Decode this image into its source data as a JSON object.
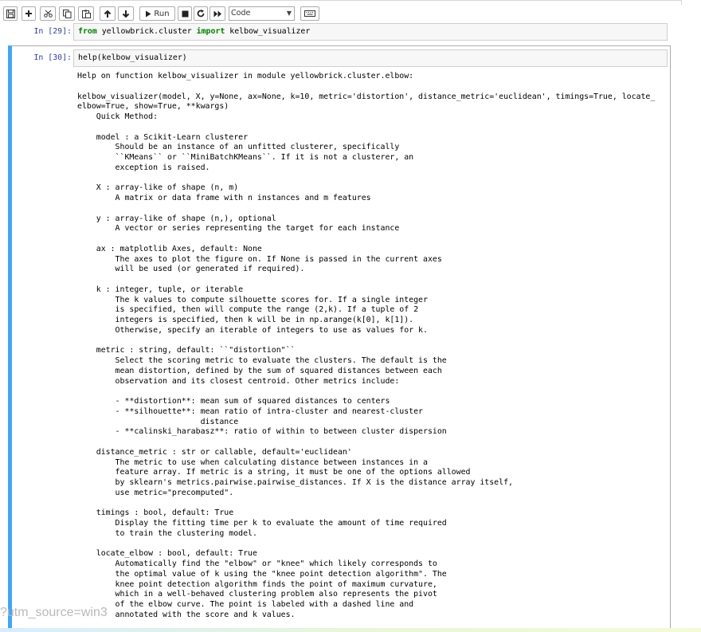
{
  "toolbar": {
    "run_label": "Run",
    "cell_type": "Code",
    "icons": [
      "save-icon",
      "add-icon",
      "cut-icon",
      "copy-icon",
      "paste-icon",
      "move-up-icon",
      "move-down-icon",
      "run-icon",
      "stop-icon",
      "restart-icon",
      "fast-forward-icon",
      "keyboard-icon"
    ]
  },
  "cells": [
    {
      "prompt": "In [29]:",
      "code_kw1": "from",
      "code_mod": " yellowbrick.cluster ",
      "code_kw2": "import",
      "code_rest": " kelbow_visualizer"
    },
    {
      "prompt": "In [30]:",
      "code": "help(kelbow_visualizer)"
    }
  ],
  "output": {
    "text": "Help on function kelbow_visualizer in module yellowbrick.cluster.elbow:\n\nkelbow_visualizer(model, X, y=None, ax=None, k=10, metric='distortion', distance_metric='euclidean', timings=True, locate_\nelbow=True, show=True, **kwargs)\n    Quick Method:\n\n    model : a Scikit-Learn clusterer\n        Should be an instance of an unfitted clusterer, specifically\n        ``KMeans`` or ``MiniBatchKMeans``. If it is not a clusterer, an\n        exception is raised.\n\n    X : array-like of shape (n, m)\n        A matrix or data frame with n instances and m features\n\n    y : array-like of shape (n,), optional\n        A vector or series representing the target for each instance\n\n    ax : matplotlib Axes, default: None\n        The axes to plot the figure on. If None is passed in the current axes\n        will be used (or generated if required).\n\n    k : integer, tuple, or iterable\n        The k values to compute silhouette scores for. If a single integer\n        is specified, then will compute the range (2,k). If a tuple of 2\n        integers is specified, then k will be in np.arange(k[0], k[1]).\n        Otherwise, specify an iterable of integers to use as values for k.\n\n    metric : string, default: ``\"distortion\"``\n        Select the scoring metric to evaluate the clusters. The default is the\n        mean distortion, defined by the sum of squared distances between each\n        observation and its closest centroid. Other metrics include:\n\n        - **distortion**: mean sum of squared distances to centers\n        - **silhouette**: mean ratio of intra-cluster and nearest-cluster\n                          distance\n        - **calinski_harabasz**: ratio of within to between cluster dispersion\n\n    distance_metric : str or callable, default='euclidean'\n        The metric to use when calculating distance between instances in a\n        feature array. If metric is a string, it must be one of the options allowed\n        by sklearn's metrics.pairwise.pairwise_distances. If X is the distance array itself,\n        use metric=\"precomputed\".\n\n    timings : bool, default: True\n        Display the fitting time per k to evaluate the amount of time required\n        to train the clustering model.\n\n    locate_elbow : bool, default: True\n        Automatically find the \"elbow\" or \"knee\" which likely corresponds to\n        the optimal value of k using the \"knee point detection algorithm\". The\n        knee point detection algorithm finds the point of maximum curvature,\n        which in a well-behaved clustering problem also represents the pivot\n        of the elbow curve. The point is labeled with a dashed line and\n        annotated with the score and k values."
  },
  "overlay_url": "?utm_source=win3"
}
